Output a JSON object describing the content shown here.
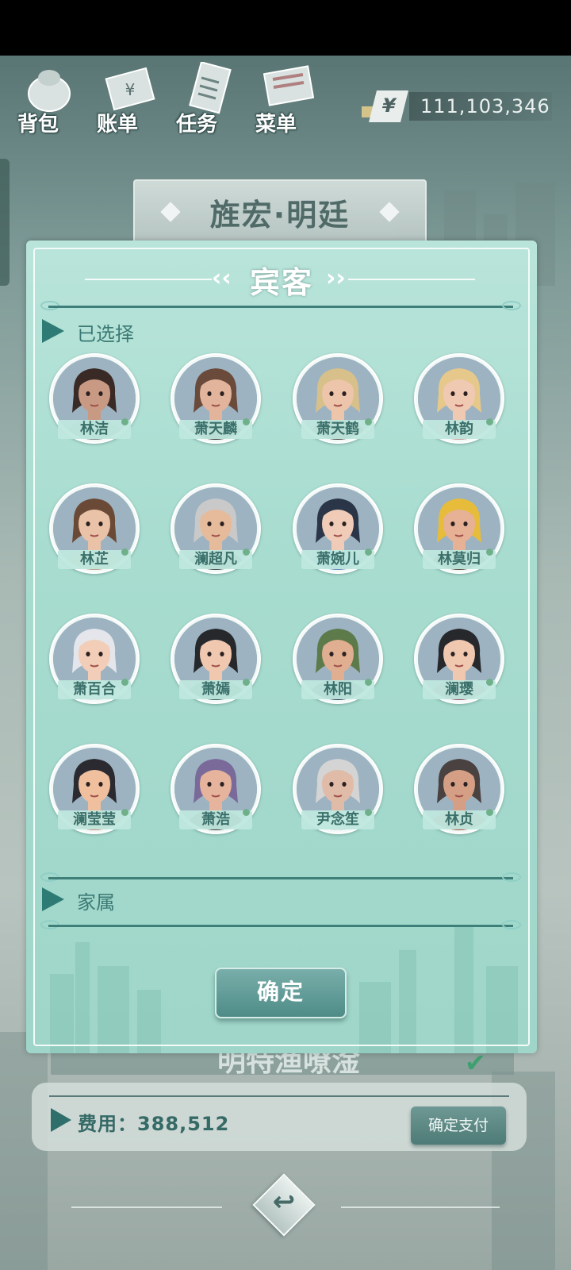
{
  "toolbar": {
    "items": [
      {
        "label": "背包",
        "icon": "backpack-icon"
      },
      {
        "label": "账单",
        "icon": "bill-icon"
      },
      {
        "label": "任务",
        "icon": "task-icon"
      },
      {
        "label": "菜单",
        "icon": "menu-book-icon"
      }
    ],
    "currency_symbol": "¥",
    "money": "111,103,346"
  },
  "restaurant": {
    "name": "旌宏·明廷"
  },
  "dialog": {
    "title": "宾客",
    "title_left_mark": "‹‹",
    "title_right_mark": "››",
    "selected_section": "已选择",
    "family_section": "家属",
    "confirm_label": "确定"
  },
  "guests": [
    {
      "name": "林洁",
      "hair": "#3a2a26",
      "skin": "#c89a83",
      "shirt": "#7c8a8a"
    },
    {
      "name": "萧天麟",
      "hair": "#6a4a3a",
      "skin": "#e1b49b",
      "shirt": "#3a3634"
    },
    {
      "name": "萧天鹤",
      "hair": "#d8c08a",
      "skin": "#ecc5aa",
      "shirt": "#4a4644"
    },
    {
      "name": "林韵",
      "hair": "#e6c98a",
      "skin": "#f0c9b3",
      "shirt": "#d8a0a0"
    },
    {
      "name": "林芷",
      "hair": "#6a4a36",
      "skin": "#eac2a8",
      "shirt": "#c0a58a"
    },
    {
      "name": "澜超凡",
      "hair": "#c9c9c9",
      "skin": "#e6bb9c",
      "shirt": "#4a4a4a"
    },
    {
      "name": "萧婉儿",
      "hair": "#2a3648",
      "skin": "#f0ccb8",
      "shirt": "#6a8bbd"
    },
    {
      "name": "林莫归",
      "hair": "#e6bc3a",
      "skin": "#e6b195",
      "shirt": "#5a4a3a"
    },
    {
      "name": "萧百合",
      "hair": "#e4e6ec",
      "skin": "#f2cdb8",
      "shirt": "#e4e6ec"
    },
    {
      "name": "萧嫣",
      "hair": "#26282c",
      "skin": "#f0c8b0",
      "shirt": "#2f5a52"
    },
    {
      "name": "林阳",
      "hair": "#5d7a4a",
      "skin": "#e0ae90",
      "shirt": "#2c3d55"
    },
    {
      "name": "澜璎",
      "hair": "#26282c",
      "skin": "#f0c8b0",
      "shirt": "#a04a6a"
    },
    {
      "name": "澜莹莹",
      "hair": "#2a2a30",
      "skin": "#f0c09e",
      "shirt": "#d88a7a"
    },
    {
      "name": "萧浩",
      "hair": "#7a6a9a",
      "skin": "#e6b49c",
      "shirt": "#3a3030"
    },
    {
      "name": "尹念笙",
      "hair": "#d4d4d4",
      "skin": "#e0bba8",
      "shirt": "#dfe6e8"
    },
    {
      "name": "林贞",
      "hair": "#4a4240",
      "skin": "#d59f86",
      "shirt": "#b04a3a"
    }
  ],
  "behind": {
    "dish_text": "明特渔嘹淦"
  },
  "cost": {
    "label": "费用：",
    "value": "388,512",
    "pay_label": "确定支付"
  },
  "colors": {
    "dialog_bg": "#a7dccf",
    "accent": "#2e7b76",
    "button": "#4e8c88"
  }
}
